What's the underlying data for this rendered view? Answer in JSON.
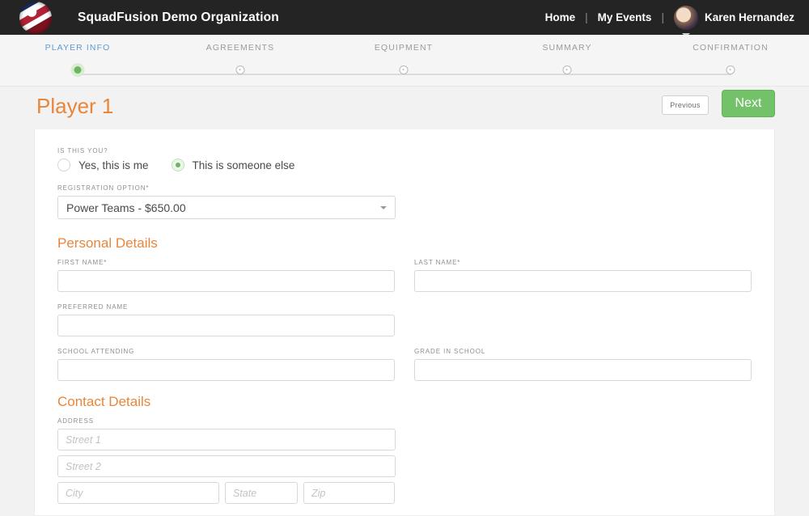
{
  "topbar": {
    "logo_icon": "usa-volleyball-logo-icon",
    "org_title": "SquadFusion Demo Organization",
    "nav": [
      {
        "label": "Home",
        "name": "home"
      },
      {
        "label": "My Events",
        "name": "my-events"
      }
    ],
    "separator": "|",
    "user_name": "Karen Hernandez",
    "avatar_icon": "user-avatar",
    "caret_icon": "chevron-down-icon"
  },
  "steps": [
    {
      "label": "PLAYER INFO",
      "state": "active"
    },
    {
      "label": "AGREEMENTS",
      "state": "pending"
    },
    {
      "label": "EQUIPMENT",
      "state": "pending"
    },
    {
      "label": "SUMMARY",
      "state": "pending"
    },
    {
      "label": "CONFIRMATION",
      "state": "pending"
    }
  ],
  "page": {
    "title": "Player 1",
    "previous_label": "Previous",
    "next_label": "Next"
  },
  "form": {
    "is_this_you": {
      "label": "IS THIS YOU?",
      "options": [
        {
          "label": "Yes, this is me",
          "selected": false
        },
        {
          "label": "This is someone else",
          "selected": true
        }
      ]
    },
    "registration_option": {
      "label": "REGISTRATION OPTION*",
      "value": "Power Teams - $650.00"
    },
    "personal_details": {
      "title": "Personal Details",
      "first_name": {
        "label": "FIRST NAME*",
        "value": "",
        "placeholder": ""
      },
      "last_name": {
        "label": "LAST NAME*",
        "value": "",
        "placeholder": ""
      },
      "preferred_name": {
        "label": "PREFERRED NAME",
        "value": "",
        "placeholder": ""
      },
      "school_attending": {
        "label": "SCHOOL ATTENDING",
        "value": "",
        "placeholder": ""
      },
      "grade_in_school": {
        "label": "GRADE IN SCHOOL",
        "value": "",
        "placeholder": ""
      }
    },
    "contact_details": {
      "title": "Contact Details",
      "address_label": "ADDRESS",
      "street1": {
        "placeholder": "Street 1",
        "value": ""
      },
      "street2": {
        "placeholder": "Street 2",
        "value": ""
      },
      "city": {
        "placeholder": "City",
        "value": ""
      },
      "state": {
        "placeholder": "State",
        "value": ""
      },
      "zip": {
        "placeholder": "Zip",
        "value": ""
      }
    }
  },
  "colors": {
    "topbar_bg": "#242424",
    "accent_orange": "#e8863b",
    "accent_green": "#73c26a",
    "step_active_blue": "#5b9bd5",
    "page_bg": "#f2f2f2"
  }
}
